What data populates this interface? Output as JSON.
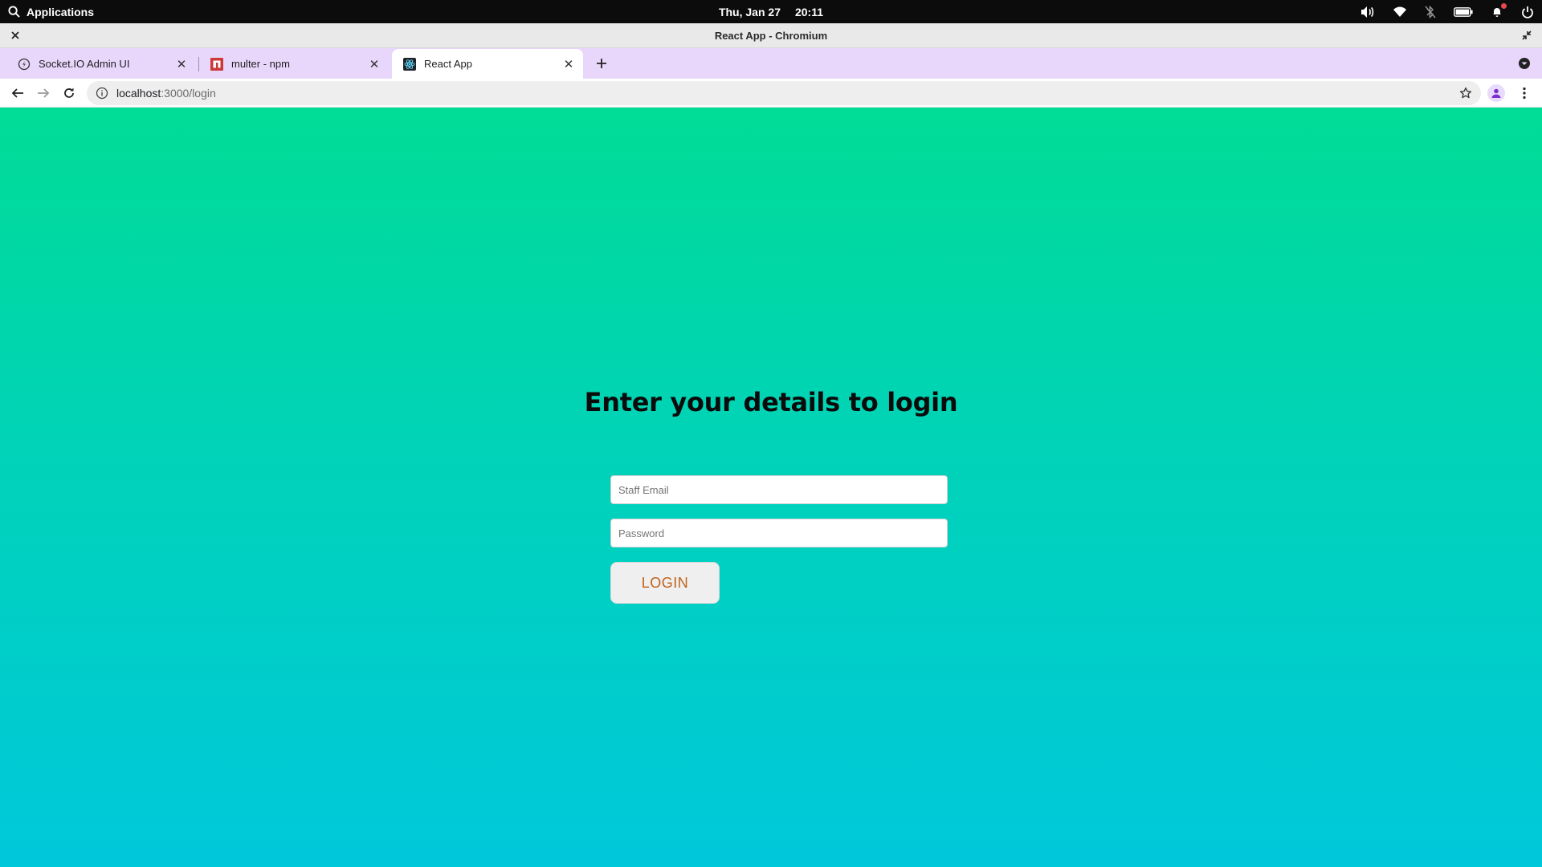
{
  "system_bar": {
    "activities_label": "Applications",
    "date": "Thu, Jan 27",
    "time": "20:11"
  },
  "window": {
    "title": "React App - Chromium"
  },
  "tabs": [
    {
      "title": "Socket.IO Admin UI",
      "icon": "socketio-icon",
      "active": false
    },
    {
      "title": "multer - npm",
      "icon": "npm-icon",
      "active": false
    },
    {
      "title": "React App",
      "icon": "react-icon",
      "active": true
    }
  ],
  "address_bar": {
    "host": "localhost",
    "path": ":3000/login"
  },
  "page": {
    "heading": "Enter your details to login",
    "email_placeholder": "Staff Email",
    "password_placeholder": "Password",
    "login_label": "LOGIN"
  },
  "colors": {
    "gradient_top": "#01dc96",
    "gradient_bottom": "#00c8db",
    "tab_strip": "#e8d6fb",
    "login_text": "#c0621a"
  }
}
